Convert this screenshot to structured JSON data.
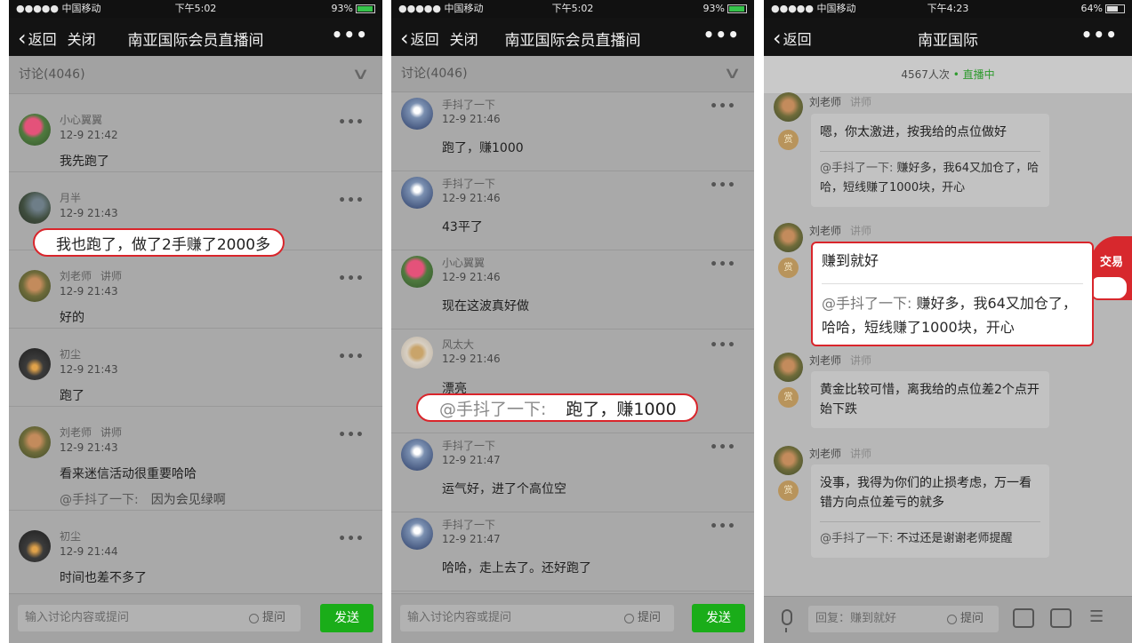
{
  "status1": {
    "carrier": "●●●●● 中国移动",
    "time": "下午5:02",
    "battery": "93%"
  },
  "status2": {
    "carrier": "●●●●● 中国移动",
    "time": "下午5:02",
    "battery": "93%"
  },
  "status3": {
    "carrier": "●●●●● 中国移动",
    "time": "下午4:23",
    "battery": "64%"
  },
  "nav1": {
    "back": "返回",
    "close": "关闭",
    "title": "南亚国际会员直播间"
  },
  "nav2": {
    "back": "返回",
    "close": "关闭",
    "title": "南亚国际会员直播间"
  },
  "nav3": {
    "back": "返回",
    "title": "南亚国际"
  },
  "discussion_header": "讨论(4046)",
  "phone1": {
    "items": [
      {
        "name": "小心翼翼",
        "role": "",
        "time": "12-9 21:42",
        "text": "我先跑了"
      },
      {
        "name": "月半",
        "role": "",
        "time": "12-9 21:43",
        "text": ""
      },
      {
        "name": "刘老师",
        "role": "讲师",
        "time": "12-9 21:43",
        "text": "好的"
      },
      {
        "name": "初尘",
        "role": "",
        "time": "12-9 21:43",
        "text": "跑了"
      },
      {
        "name": "刘老师",
        "role": "讲师",
        "time": "12-9 21:43",
        "text": "看来迷信活动很重要哈哈",
        "reply_at": "@手抖了一下:",
        "reply_text": "因为会见绿啊"
      },
      {
        "name": "初尘",
        "role": "",
        "time": "12-9 21:44",
        "text": "时间也差不多了"
      }
    ],
    "highlight": "我也跑了，做了2手赚了2000多",
    "input_placeholder": "输入讨论内容或提问",
    "ask_label": "提问",
    "send_label": "发送"
  },
  "phone2": {
    "items": [
      {
        "name": "手抖了一下",
        "time": "12-9 21:46",
        "text": "跑了，赚1000"
      },
      {
        "name": "手抖了一下",
        "time": "12-9 21:46",
        "text": "43平了"
      },
      {
        "name": "小心翼翼",
        "time": "12-9 21:46",
        "text": "现在这波真好做"
      },
      {
        "name": "风太大",
        "time": "12-9 21:46",
        "text": "漂亮"
      },
      {
        "name": "手抖了一下",
        "time": "12-9 21:47",
        "text": "运气好，进了个高位空"
      },
      {
        "name": "手抖了一下",
        "time": "12-9 21:47",
        "text": "哈哈，走上去了。还好跑了"
      }
    ],
    "highlight_at": "@手抖了一下:",
    "highlight_text": "跑了，赚1000",
    "input_placeholder": "输入讨论内容或提问",
    "ask_label": "提问",
    "send_label": "发送"
  },
  "phone3": {
    "viewers": "4567人次",
    "live_label": "• 直播中",
    "reward_label": "赏",
    "messages": [
      {
        "name": "刘老师",
        "role": "讲师",
        "text": "嗯，你太激进，按我给的点位做好",
        "quote_at": "@手抖了一下:",
        "quote_text": "赚好多，我64又加仓了，哈哈，短线赚了1000块，开心"
      },
      {
        "name": "刘老师",
        "role": "讲师",
        "text": "赚到就好",
        "quote_at": "@手抖了一下:",
        "quote_text": "赚好多，我64又加仓了，哈哈，短线赚了1000块，开心"
      },
      {
        "name": "刘老师",
        "role": "讲师",
        "text": "黄金比较可惜，离我给的点位差2个点开始下跌"
      },
      {
        "name": "刘老师",
        "role": "讲师",
        "text": "没事，我得为你们的止损考虑，万一看错方向点位差亏的就多",
        "quote_at": "@手抖了一下:",
        "quote_text": "不过还是谢谢老师提醒"
      }
    ],
    "trade_label": "交易",
    "reply_placeholder": "回复：赚到就好",
    "ask_label": "提问"
  },
  "colors": {
    "highlight_border": "#d9252b",
    "send_button": "#1aad19",
    "live": "#2d9a2d",
    "trade_badge": "#d7282d"
  }
}
